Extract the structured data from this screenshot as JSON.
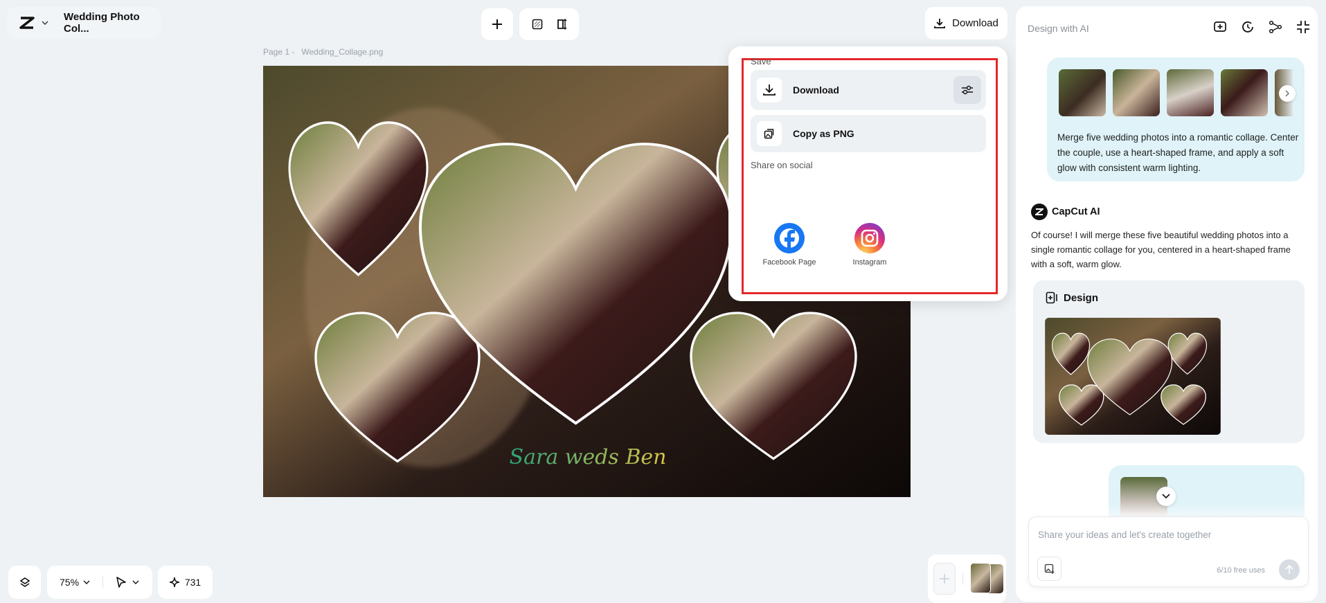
{
  "header": {
    "project_title": "Wedding Photo Col...",
    "download_label": "Download"
  },
  "canvas": {
    "page_label": "Page 1 -",
    "file_name": "Wedding_Collage.png",
    "caption": "Sara weds Ben"
  },
  "download_menu": {
    "save_heading": "Save",
    "download_label": "Download",
    "copy_label": "Copy as PNG",
    "share_heading": "Share on social",
    "social": [
      {
        "label": "Facebook Page",
        "icon": "facebook-icon",
        "color": "#1877f2"
      },
      {
        "label": "Instagram",
        "icon": "instagram-icon"
      }
    ]
  },
  "ai_panel": {
    "title": "Design with AI",
    "user_prompt": "Merge five wedding photos into a romantic collage. Center the couple, use a heart-shaped frame, and apply a soft glow with consistent warm lighting.",
    "assistant_name": "CapCut AI",
    "assistant_reply": "Of course! I will merge these five beautiful wedding photos into a single romantic collage for you, centered in a heart-shaped frame with a soft, warm glow.",
    "design_card_title": "Design",
    "input_placeholder": "Share your ideas and let's create together",
    "free_uses": "6/10 free uses"
  },
  "bottom_bar": {
    "zoom": "75%",
    "credits": "731"
  },
  "colors": {
    "accent_red": "#e5262a",
    "bubble": "#dff3f8",
    "background": "#eef2f5"
  }
}
